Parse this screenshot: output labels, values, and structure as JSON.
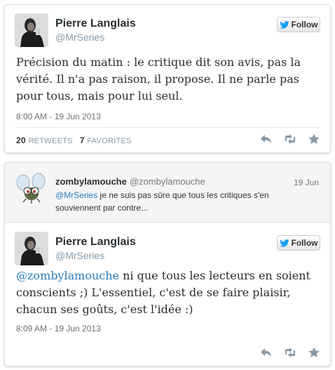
{
  "follow_label": "Follow",
  "tweet1": {
    "name": "Pierre Langlais",
    "handle": "@MrSeries",
    "text": "Précision du matin : le critique dit son avis, pas la vérité. Il n'a pas raison, il propose. Il ne parle pas pour tous, mais pour lui seul.",
    "date": "8:00 AM - 19 Jun 2013",
    "retweets_count": "20",
    "retweets_label": "RETWEETS",
    "favorites_count": "7",
    "favorites_label": "FAVORITES"
  },
  "reply_context": {
    "name": "zombylamouche",
    "handle": "@zombylamouche",
    "date": "19 Jun",
    "mention": "@MrSeries",
    "text": " je ne suis pas sûre que tous les critiques s'en souviennent par contre..."
  },
  "tweet2": {
    "name": "Pierre Langlais",
    "handle": "@MrSeries",
    "mention": "@zombylamouche",
    "text": " ni que tous les lecteurs en soient conscients ;) L'essentiel, c'est de se faire plaisir, chacun ses goûts, c'est l'idée :)",
    "date": "8:09 AM - 19 Jun 2013"
  },
  "colors": {
    "link": "#2b7bb9",
    "twitter_bird": "#1da1f2"
  }
}
